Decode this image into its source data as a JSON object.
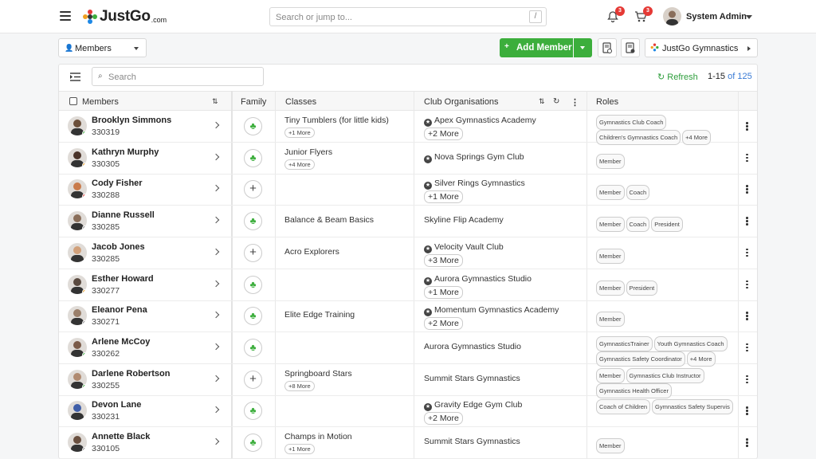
{
  "app": {
    "brand": "JustGo",
    "brand_suffix": ".com"
  },
  "header": {
    "search_placeholder": "Search or jump to...",
    "search_shortcut": "/",
    "notifications_count": "3",
    "cart_count": "3",
    "user_name": "System Admin"
  },
  "toolbar": {
    "view_label": "Members",
    "add_label": "Add Member",
    "org_label": "JustGo Gymnastics"
  },
  "list": {
    "search_placeholder": "Search",
    "refresh_label": "Refresh",
    "page_range": "1-15",
    "page_of": "of",
    "page_total": "125"
  },
  "columns": {
    "members": "Members",
    "family": "Family",
    "classes": "Classes",
    "clubs": "Club Organisations",
    "roles": "Roles"
  },
  "colors": {
    "accent": "#3cae3c",
    "badge": "#e53935"
  },
  "rows": [
    {
      "name": "Brooklyn Simmons",
      "id": "330319",
      "family": "tree",
      "cls": "Tiny Tumblers (for little kids)",
      "cls_more": "+1 More",
      "org": "Apex Gymnastics Academy",
      "org_star": true,
      "org_more": "+2 More",
      "roles": [
        "Gymnastics Club Coach",
        "Children's Gymnastics Coach",
        "+4 More"
      ],
      "status": "#3cae3c"
    },
    {
      "name": "Kathryn Murphy",
      "id": "330305",
      "family": "tree",
      "cls": "Junior Flyers",
      "cls_more": "+4 More",
      "org": "Nova Springs Gym Club",
      "org_star": true,
      "org_more": "",
      "roles": [
        "Member"
      ],
      "status": "#f0a020"
    },
    {
      "name": "Cody Fisher",
      "id": "330288",
      "family": "plus",
      "cls": "",
      "cls_more": "",
      "org": "Silver Rings Gymnastics",
      "org_star": true,
      "org_more": "+1 More",
      "roles": [
        "Member",
        "Coach"
      ],
      "status": "#e53935"
    },
    {
      "name": "Dianne Russell",
      "id": "330285",
      "family": "tree",
      "cls": "Balance & Beam Basics",
      "cls_more": "",
      "org": "Skyline Flip Academy",
      "org_star": false,
      "org_more": "",
      "roles": [
        "Member",
        "Coach",
        "President"
      ],
      "status": "#888888"
    },
    {
      "name": "Jacob Jones",
      "id": "330285",
      "family": "plus",
      "cls": "Acro Explorers",
      "cls_more": "",
      "org": "Velocity Vault Club",
      "org_star": true,
      "org_more": "+3 More",
      "roles": [
        "Member"
      ],
      "status": ""
    },
    {
      "name": "Esther Howard",
      "id": "330277",
      "family": "tree",
      "cls": "",
      "cls_more": "",
      "org": "Aurora Gymnastics Studio",
      "org_star": true,
      "org_more": "+1 More",
      "roles": [
        "Member",
        "President"
      ],
      "status": "#f0a020"
    },
    {
      "name": "Eleanor Pena",
      "id": "330271",
      "family": "tree",
      "cls": "Elite Edge Training",
      "cls_more": "",
      "org": "Momentum Gymnastics Academy",
      "org_star": true,
      "org_more": "+2 More",
      "roles": [
        "Member"
      ],
      "status": "#888888"
    },
    {
      "name": "Arlene McCoy",
      "id": "330262",
      "family": "tree",
      "cls": "",
      "cls_more": "",
      "org": "Aurora Gymnastics Studio",
      "org_star": false,
      "org_more": "",
      "roles": [
        "GymnasticsTrainer",
        "Youth Gymnastics Coach",
        "Gymnastics Safety Coordinator",
        "+4 More"
      ],
      "status": "#3cae3c"
    },
    {
      "name": "Darlene Robertson",
      "id": "330255",
      "family": "plus",
      "cls": "Springboard Stars",
      "cls_more": "+8 More",
      "org": "Summit Stars Gymnastics",
      "org_star": false,
      "org_more": "",
      "roles": [
        "Member",
        "Gymnastics Club Instructor",
        "Gymnastics Health Officer"
      ],
      "status": "#3cae3c"
    },
    {
      "name": "Devon Lane",
      "id": "330231",
      "family": "tree",
      "cls": "",
      "cls_more": "",
      "org": "Gravity Edge Gym Club",
      "org_star": true,
      "org_more": "+2 More",
      "roles": [
        "Coach of Children",
        "Gymnastics Safety Supervis"
      ],
      "status": ""
    },
    {
      "name": "Annette Black",
      "id": "330105",
      "family": "tree",
      "cls": "Champs in Motion",
      "cls_more": "+1 More",
      "org": "Summit Stars Gymnastics",
      "org_star": false,
      "org_more": "",
      "roles": [
        "Member"
      ],
      "status": "#888888"
    }
  ]
}
